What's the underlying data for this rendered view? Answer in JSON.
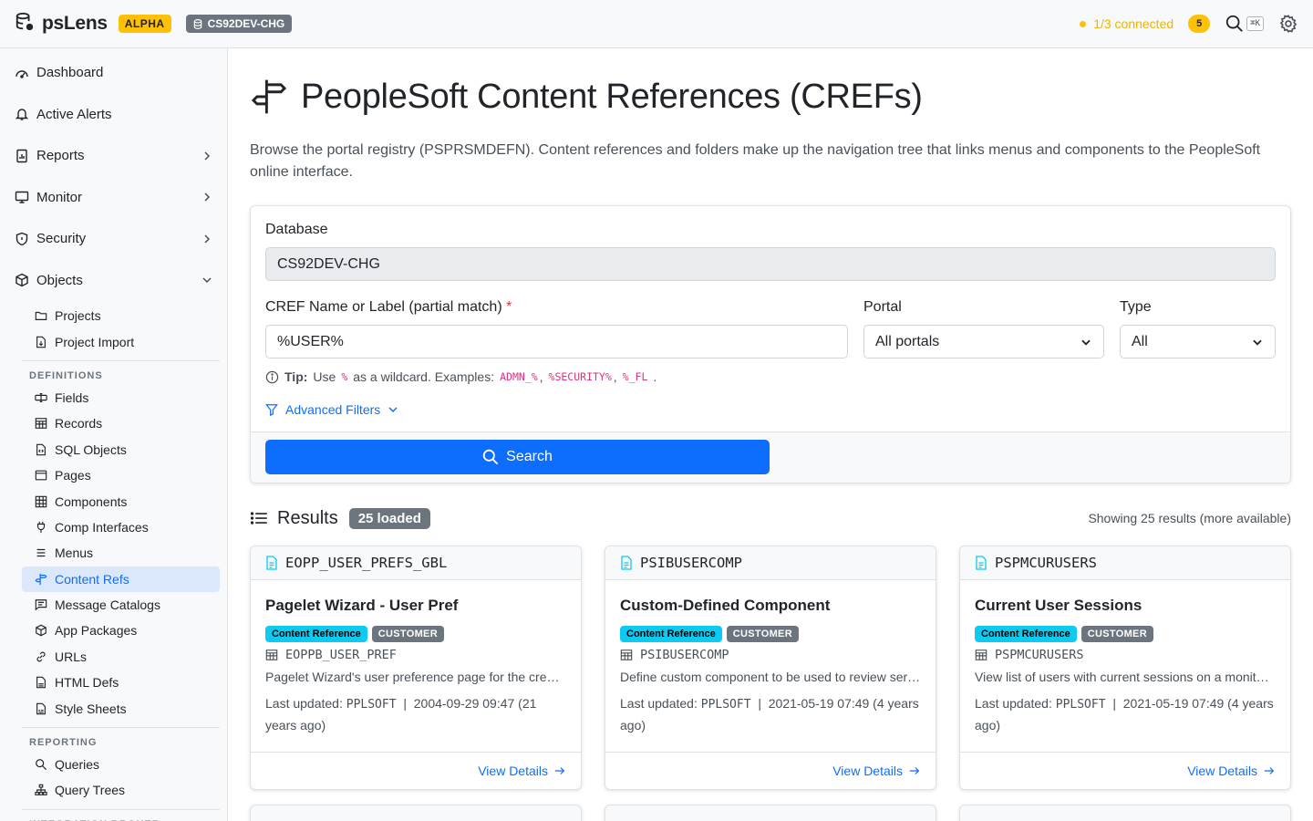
{
  "app": {
    "name": "psLens",
    "badge": "ALPHA",
    "db_chip": "CS92DEV-CHG"
  },
  "top": {
    "connection": "1/3 connected",
    "count": "5",
    "shortcut": "⌘K"
  },
  "sidebar": {
    "top_items": [
      {
        "label": "Dashboard",
        "icon": "gauge-icon"
      },
      {
        "label": "Active Alerts",
        "icon": "bell-icon"
      },
      {
        "label": "Reports",
        "icon": "report-icon"
      },
      {
        "label": "Monitor",
        "icon": "monitor-icon"
      },
      {
        "label": "Security",
        "icon": "shield-icon"
      },
      {
        "label": "Objects",
        "icon": "box-icon"
      }
    ],
    "objects_items": [
      {
        "label": "Projects"
      },
      {
        "label": "Project Import"
      }
    ],
    "definitions_heading": "DEFINITIONS",
    "definitions": [
      {
        "label": "Fields"
      },
      {
        "label": "Records"
      },
      {
        "label": "SQL Objects"
      },
      {
        "label": "Pages"
      },
      {
        "label": "Components"
      },
      {
        "label": "Comp Interfaces"
      },
      {
        "label": "Menus"
      },
      {
        "label": "Content Refs"
      },
      {
        "label": "Message Catalogs"
      },
      {
        "label": "App Packages"
      },
      {
        "label": "URLs"
      },
      {
        "label": "HTML Defs"
      },
      {
        "label": "Style Sheets"
      }
    ],
    "reporting_heading": "REPORTING",
    "reporting": [
      {
        "label": "Queries"
      },
      {
        "label": "Query Trees"
      }
    ],
    "integration_heading": "INTEGRATION BROKER"
  },
  "page": {
    "title": "PeopleSoft Content References (CREFs)",
    "intro": "Browse the portal registry (PSPRSMDEFN). Content references and folders make up the navigation tree that links menus and components to the PeopleSoft online interface."
  },
  "form": {
    "database_label": "Database",
    "database_value": "CS92DEV-CHG",
    "name_label": "CREF Name or Label (partial match)",
    "required_mark": "*",
    "name_value": "%USER%",
    "portal_label": "Portal",
    "portal_value": "All portals",
    "type_label": "Type",
    "type_value": "All",
    "tip_label": "Tip:",
    "tip_use": "Use",
    "tip_wild": "%",
    "tip_mid": "as a wildcard. Examples:",
    "tip_ex1": "ADMN_%",
    "tip_ex2": "%SECURITY%",
    "tip_ex3": "%_FL",
    "comma": ",",
    "period": ".",
    "advanced": "Advanced Filters",
    "search_button": "Search"
  },
  "results": {
    "heading": "Results",
    "loaded": "25 loaded",
    "showing": "Showing 25 results (more available)",
    "updated_label": "Last updated:",
    "view_details": "View Details",
    "cards": [
      {
        "name": "EOPP_USER_PREFS_GBL",
        "title": "Pagelet Wizard - User Pref",
        "tag1": "Content Reference",
        "tag2": "CUSTOMER",
        "record": "EOPPB_USER_PREF",
        "description": "Pagelet Wizard's user preference page for the creation of pagelets",
        "user": "PPLSOFT",
        "date": "2004-09-29 09:47 (21 years ago)"
      },
      {
        "name": "PSIBUSERCOMP",
        "title": "Custom-Defined Component",
        "tag1": "Content Reference",
        "tag2": "CUSTOMER",
        "record": "PSIBUSERCOMP",
        "description": "Define custom component to be used to review services",
        "user": "PPLSOFT",
        "date": "2021-05-19 07:49 (4 years ago)"
      },
      {
        "name": "PSPMCURUSERS",
        "title": "Current User Sessions",
        "tag1": "Content Reference",
        "tag2": "CUSTOMER",
        "record": "PSPMCURUSERS",
        "description": "View list of users with current sessions on a monitored system",
        "user": "PPLSOFT",
        "date": "2021-05-19 07:49 (4 years ago)"
      }
    ]
  },
  "colors": {
    "primary": "#0d6efd",
    "warning": "#ffc107",
    "info": "#0dcaf0",
    "secondary": "#6c757d"
  }
}
